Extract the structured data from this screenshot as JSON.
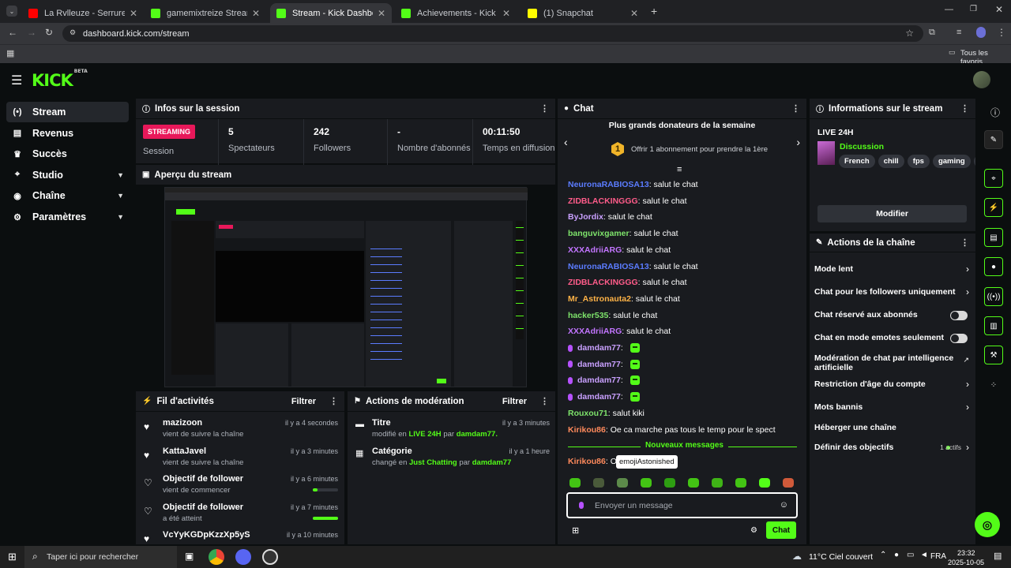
{
  "browser": {
    "tabs": [
      {
        "title": "La Rvlleuze - Serrure #5 - YouT",
        "color": "#ff0000"
      },
      {
        "title": "gamemixtreize Stream - Watch",
        "color": "#53fc18"
      },
      {
        "title": "Stream - Kick Dashboard",
        "color": "#53fc18"
      },
      {
        "title": "Achievements - Kick Dashboard",
        "color": "#53fc18"
      },
      {
        "title": "(1) Snapchat",
        "color": "#fffc00"
      }
    ],
    "url": "dashboard.kick.com/stream",
    "bookmarks_label": "Tous les favoris"
  },
  "brand": {
    "logo": "KICK",
    "beta": "BETA"
  },
  "sidebar": {
    "items": [
      {
        "label": "Stream",
        "icon": "broadcast-icon"
      },
      {
        "label": "Revenus",
        "icon": "revenue-icon"
      },
      {
        "label": "Succès",
        "icon": "trophy-icon"
      },
      {
        "label": "Studio",
        "icon": "studio-icon"
      },
      {
        "label": "Chaîne",
        "icon": "channel-icon"
      },
      {
        "label": "Paramètres",
        "icon": "gear-icon"
      }
    ]
  },
  "session": {
    "title": "Infos sur la session",
    "badge": "STREAMING",
    "badge_label": "Session",
    "stats": [
      {
        "value": "5",
        "label": "Spectateurs"
      },
      {
        "value": "242",
        "label": "Followers"
      },
      {
        "value": "-",
        "label": "Nombre d'abonnés"
      },
      {
        "value": "00:11:50",
        "label": "Temps en diffusion"
      }
    ]
  },
  "preview": {
    "title": "Aperçu du stream"
  },
  "activity": {
    "title": "Fil d'activités",
    "filter": "Filtrer",
    "items": [
      {
        "name": "mazizoon",
        "desc": "vient de suivre la chaîne",
        "time": "il y a 4 secondes",
        "type": "follow"
      },
      {
        "name": "KattaJavel",
        "desc": "vient de suivre la chaîne",
        "time": "il y a 3 minutes",
        "type": "follow"
      },
      {
        "name": "Objectif de follower",
        "desc": "vient de commencer",
        "time": "il y a 6 minutes",
        "type": "goal",
        "progress": 0.2
      },
      {
        "name": "Objectif de follower",
        "desc": "a été atteint",
        "time": "il y a 7 minutes",
        "type": "goal",
        "progress": 1.0
      },
      {
        "name": "VcYyKGDpKzzXp5yS",
        "desc": "",
        "time": "il y a 10 minutes",
        "type": "follow"
      }
    ]
  },
  "moderation": {
    "title": "Actions de modération",
    "filter": "Filtrer",
    "items": [
      {
        "title": "Titre",
        "pre": "modifié en",
        "value": "LIVE 24H",
        "by": "par",
        "user": "damdam77.",
        "time": "il y a 3 minutes"
      },
      {
        "title": "Catégorie",
        "pre": "changé en",
        "value": "Just Chatting",
        "by": "par",
        "user": "damdam77",
        "time": "il y a 1 heure"
      }
    ]
  },
  "chat": {
    "title": "Chat",
    "donor_title": "Plus grands donateurs de la semaine",
    "donor_rank": "1",
    "donor_text": "Offrir 1 abonnement pour prendre la 1ère",
    "messages": [
      {
        "user": "NeuronaRABIOSA13",
        "color": "#5b7cff",
        "text": "salut le chat"
      },
      {
        "user": "ZIDBLACKINGGG",
        "color": "#ff5c8a",
        "text": "salut le chat"
      },
      {
        "user": "ByJordix",
        "color": "#c9a0ff",
        "text": "salut le chat"
      },
      {
        "user": "banguvixgamer",
        "color": "#7ee36b",
        "text": "salut le chat"
      },
      {
        "user": "XXXAdriiARG",
        "color": "#c275ff",
        "text": "salut le chat"
      },
      {
        "user": "NeuronaRABIOSA13",
        "color": "#5b7cff",
        "text": "salut le chat"
      },
      {
        "user": "ZIDBLACKINGGG",
        "color": "#ff5c8a",
        "text": "salut le chat"
      },
      {
        "user": "Mr_Astronauta2",
        "color": "#ffb347",
        "text": "salut le chat"
      },
      {
        "user": "hacker535",
        "color": "#7ee36b",
        "text": "salut le chat"
      },
      {
        "user": "XXXAdriiARG",
        "color": "#c275ff",
        "text": "salut le chat"
      },
      {
        "user": "damdam77",
        "color": "#c9a0ff",
        "text": "",
        "emote": true
      },
      {
        "user": "damdam77",
        "color": "#c9a0ff",
        "text": "",
        "emote": true
      },
      {
        "user": "damdam77",
        "color": "#c9a0ff",
        "text": "",
        "emote": true
      },
      {
        "user": "damdam77",
        "color": "#c9a0ff",
        "text": "",
        "emote": true
      },
      {
        "user": "Rouxou71",
        "color": "#7ee36b",
        "text": "salut kiki"
      },
      {
        "user": "Kirikou86",
        "color": "#ff8a5c",
        "text": "Oe ca marche pas tous le temp pour le spect"
      }
    ],
    "new_messages": "Nouveaux messages",
    "last_user": "Kirikou86",
    "last_text": "OE",
    "tooltip": "emojiAstonished",
    "placeholder": "Envoyer un message",
    "send": "Chat"
  },
  "stream_info": {
    "title": "Informations sur le stream",
    "stream_title": "LIVE 24H",
    "category": "Discussion",
    "tags": [
      "French",
      "chill",
      "fps",
      "gaming",
      "fu"
    ],
    "edit": "Modifier"
  },
  "channel_actions": {
    "title": "Actions de la chaîne",
    "items": [
      {
        "label": "Mode lent",
        "control": "arrow"
      },
      {
        "label": "Chat pour les followers uniquement",
        "control": "arrow"
      },
      {
        "label": "Chat réservé aux abonnés",
        "control": "toggle"
      },
      {
        "label": "Chat en mode emotes seulement",
        "control": "toggle"
      },
      {
        "label": "Modération de chat par intelligence artificielle",
        "control": "external"
      },
      {
        "label": "Restriction d'âge du compte",
        "control": "arrow"
      },
      {
        "label": "Mots bannis",
        "control": "arrow"
      },
      {
        "label": "Héberger une chaîne",
        "control": "none"
      },
      {
        "label": "Définir des objectifs",
        "control": "arrow",
        "badge": "1 actifs"
      }
    ]
  },
  "taskbar": {
    "search": "Taper ici pour rechercher",
    "weather": "11°C Ciel couvert",
    "lang": "FRA",
    "time": "23:32",
    "date": "2025-10-05"
  }
}
